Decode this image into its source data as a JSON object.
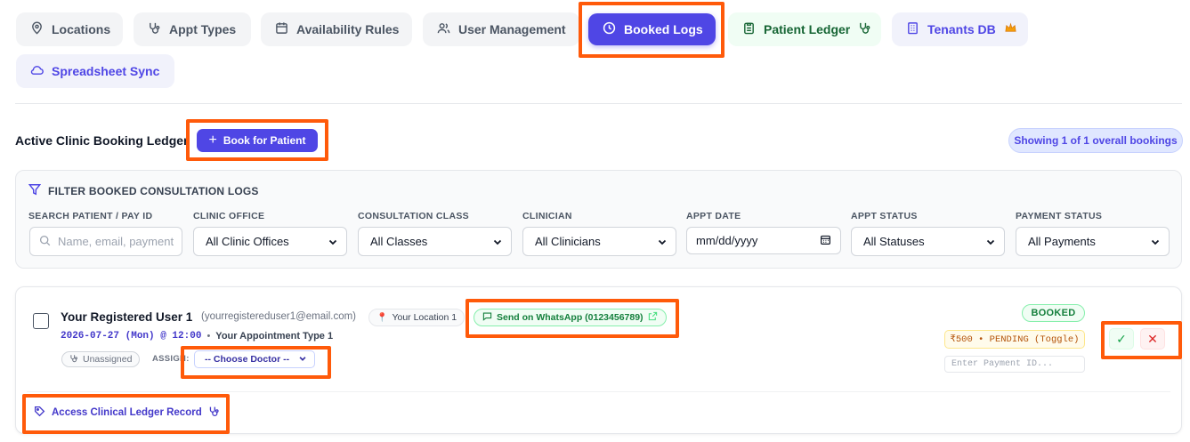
{
  "nav": {
    "tabs": [
      {
        "label": "Locations",
        "icon": "map-pin-icon"
      },
      {
        "label": "Appt Types",
        "icon": "stethoscope-icon"
      },
      {
        "label": "Availability Rules",
        "icon": "calendar-icon"
      },
      {
        "label": "User Management",
        "icon": "users-icon"
      },
      {
        "label": "Booked Logs",
        "icon": "clock-icon",
        "active": true
      },
      {
        "label": "Patient Ledger",
        "icon": "clipboard-icon"
      },
      {
        "label": "Tenants DB",
        "icon": "building-icon"
      },
      {
        "label": "Spreadsheet Sync",
        "icon": "cloud-icon"
      }
    ]
  },
  "header": {
    "title": "Active Clinic Booking Ledger",
    "book_button": "Book for Patient",
    "count_badge": "Showing 1 of 1 overall bookings"
  },
  "filters": {
    "title": "FILTER BOOKED CONSULTATION LOGS",
    "search": {
      "label": "SEARCH PATIENT / PAY ID",
      "placeholder": "Name, email, payment"
    },
    "clinic": {
      "label": "CLINIC OFFICE",
      "value": "All Clinic Offices"
    },
    "class": {
      "label": "CONSULTATION CLASS",
      "value": "All Classes"
    },
    "clinician": {
      "label": "CLINICIAN",
      "value": "All Clinicians"
    },
    "date": {
      "label": "APPT DATE",
      "value": "mm/dd/yyyy"
    },
    "status": {
      "label": "APPT STATUS",
      "value": "All Statuses"
    },
    "payment": {
      "label": "PAYMENT STATUS",
      "value": "All Payments"
    }
  },
  "booking": {
    "patient_name": "Your Registered User 1",
    "email": "(yourregistereduser1@email.com)",
    "location": "Your Location 1",
    "whatsapp": "Send on WhatsApp (0123456789)",
    "datetime": "2026-07-27 (Mon) @ 12:00",
    "separator": "•",
    "appt_type": "Your Appointment Type 1",
    "assignee": "Unassigned",
    "assign_label": "ASSIGN:",
    "doctor_select": "-- Choose Doctor --",
    "status": "BOOKED",
    "payment": "₹500 • PENDING (Toggle)",
    "payment_id_placeholder": "Enter Payment ID...",
    "approve": "✓",
    "reject": "✕",
    "ledger_link": "Access Clinical Ledger Record"
  },
  "colors": {
    "accent": "#4f46e5",
    "highlight": "#ff5a0a",
    "success": "#15803d",
    "warning": "#b45309",
    "danger": "#dc2626"
  }
}
